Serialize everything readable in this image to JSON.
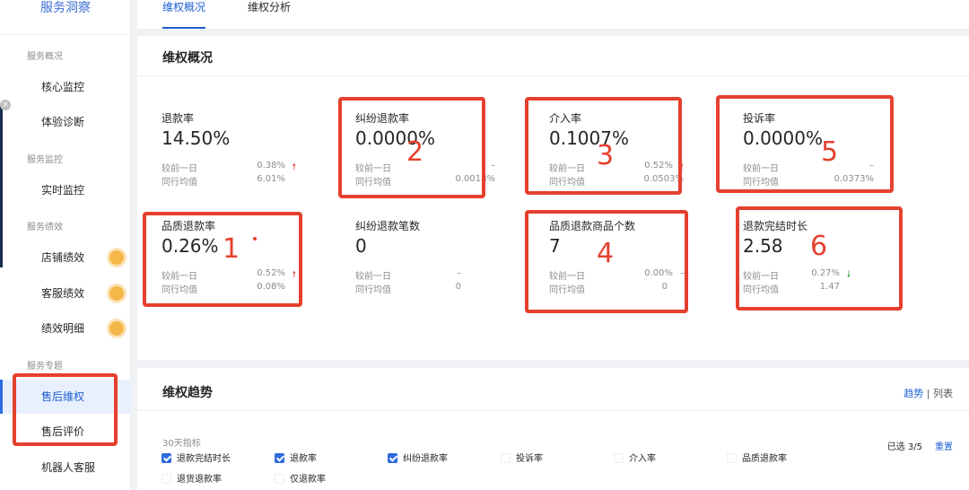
{
  "sidebar": {
    "title": "服务洞察",
    "sections": [
      {
        "label": "服务概况"
      },
      {
        "label": "服务监控"
      },
      {
        "label": "服务绩效"
      },
      {
        "label": "服务专题"
      }
    ],
    "items": [
      {
        "label": "核心监控"
      },
      {
        "label": "体验诊断"
      },
      {
        "label": "实时监控"
      },
      {
        "label": "店铺绩效"
      },
      {
        "label": "客服绩效"
      },
      {
        "label": "绩效明细"
      },
      {
        "label": "售后维权"
      },
      {
        "label": "售后评价"
      },
      {
        "label": "机器人客服"
      }
    ]
  },
  "tabs": [
    {
      "label": "维权概况"
    },
    {
      "label": "维权分析"
    }
  ],
  "overview": {
    "title": "维权概况",
    "metrics": [
      {
        "name": "退款率",
        "value": "14.50%",
        "r1_label": "较前一日",
        "r1_value": "0.38%",
        "r1_arrow": "up",
        "r2_label": "同行均值",
        "r2_value": "6.01%"
      },
      {
        "name": "纠纷退款率",
        "value": "0.0000%",
        "r1_label": "较前一日",
        "r1_value": "–",
        "r1_arrow": "none",
        "r2_label": "同行均值",
        "r2_value": "0.0018%"
      },
      {
        "name": "介入率",
        "value": "0.1007%",
        "r1_label": "较前一日",
        "r1_value": "0.52%",
        "r1_arrow": "up",
        "r2_label": "同行均值",
        "r2_value": "0.0503%"
      },
      {
        "name": "投诉率",
        "value": "0.0000%",
        "r1_label": "较前一日",
        "r1_value": "–",
        "r1_arrow": "none",
        "r2_label": "同行均值",
        "r2_value": "0.0373%"
      },
      {
        "name": "品质退款率",
        "value": "0.26%",
        "r1_label": "较前一日",
        "r1_value": "0.52%",
        "r1_arrow": "up",
        "r2_label": "同行均值",
        "r2_value": "0.08%"
      },
      {
        "name": "纠纷退款笔数",
        "value": "0",
        "r1_label": "较前一日",
        "r1_value": "–",
        "r1_arrow": "none",
        "r2_label": "同行均值",
        "r2_value": "0"
      },
      {
        "name": "品质退款商品个数",
        "value": "7",
        "r1_label": "较前一日",
        "r1_value": "0.00%",
        "r1_arrow": "flat",
        "r2_label": "同行均值",
        "r2_value": "0"
      },
      {
        "name": "退款完结时长",
        "value": "2.58",
        "r1_label": "较前一日",
        "r1_value": "0.27%",
        "r1_arrow": "down",
        "r2_label": "同行均值",
        "r2_value": "1.47"
      }
    ]
  },
  "annotations": [
    "1",
    "2",
    "3",
    "4",
    "5",
    "6"
  ],
  "arrows": {
    "up": "🠕",
    "down": "🠗",
    "flat": "—"
  },
  "trend": {
    "title": "维权趋势",
    "view_trend": "趋势",
    "view_sep": "|",
    "view_list": "列表",
    "indicator_label": "30天指标",
    "selected_text": "已选 3/5",
    "reset_label": "重置",
    "checkboxes": [
      {
        "label": "退款完结时长",
        "checked": true
      },
      {
        "label": "退款率",
        "checked": true
      },
      {
        "label": "纠纷退款率",
        "checked": true
      },
      {
        "label": "投诉率",
        "checked": false
      },
      {
        "label": "介入率",
        "checked": false
      },
      {
        "label": "品质退款率",
        "checked": false
      },
      {
        "label": "退货退款率",
        "checked": false
      },
      {
        "label": "仅退款率",
        "checked": false
      }
    ]
  },
  "colors": {
    "accent": "#1f5fd1",
    "annotation_red": "#e5402e",
    "up": "#e53935",
    "down": "#3aa33a"
  }
}
